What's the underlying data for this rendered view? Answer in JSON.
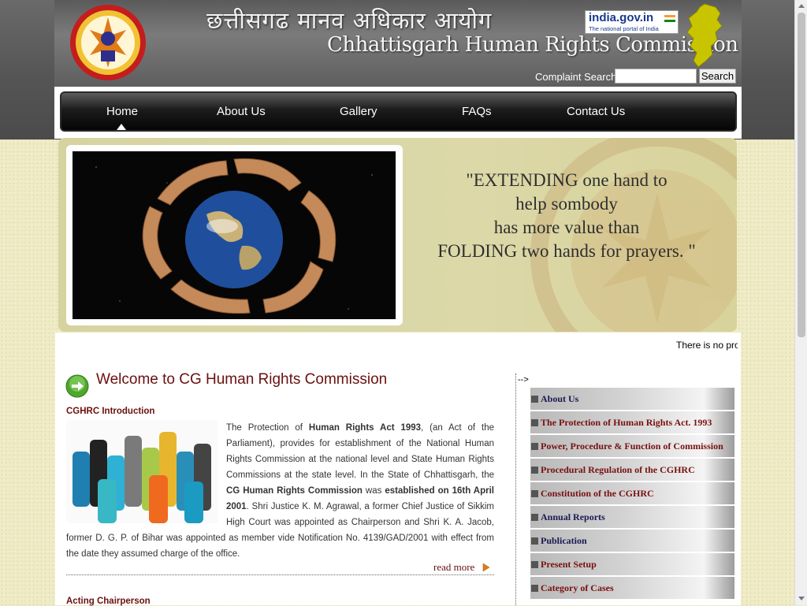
{
  "header": {
    "hindi_title": "छत्तीसगढ मानव अधिकार आयोग",
    "english_title": "Chhattisgarh Human Rights Commission",
    "india_gov": {
      "title": "india.gov.in",
      "subtitle": "The national portal of India"
    },
    "complaint_search_label": "Complaint Search:",
    "search_button": "Search",
    "search_value": ""
  },
  "nav": {
    "items": [
      {
        "label": "Home",
        "active": true
      },
      {
        "label": "About Us"
      },
      {
        "label": "Gallery"
      },
      {
        "label": "FAQs"
      },
      {
        "label": "Contact Us"
      }
    ]
  },
  "banner": {
    "quote_lines": [
      "\"EXTENDING one hand to",
      "help sombody",
      "has more value than",
      "FOLDING two hands for prayers. \""
    ]
  },
  "marquee": "There is no pro",
  "main": {
    "welcome_title": "Welcome to CG Human Rights Commission",
    "intro_heading": "CGHRC Introduction",
    "intro_parts": {
      "p1": "The Protection of ",
      "b1": "Human Rights Act 1993",
      "p2": ", (an Act of the Parliament), provides for establishment of the National Human Rights Commission at the national level and State Human Rights Commissions at the state level. In the State of Chhattisgarh, the ",
      "b2": "CG Human Rights Commission",
      "p3": " was ",
      "b3": "established on 16th April 2001",
      "p4": ". Shri Justice K. M. Agrawal, a former Chief Justice of Sikkim High Court was appointed as Chairperson and Shri K. A. Jacob, former D. G. P. of Bihar was appointed as member vide Notification No. 4139/GAD/2001 with effect from the date they assumed charge of the office."
    },
    "read_more": "read more",
    "acting_heading": "Acting Chairperson"
  },
  "stray_comment": "-->",
  "side_menu": {
    "items": [
      {
        "label": "About Us",
        "color": "#1a1a55"
      },
      {
        "label": "The Protection of Human Rights Act. 1993",
        "color": "#7a1010"
      },
      {
        "label": "Power, Procedure & Function of Commission",
        "color": "#7a1010"
      },
      {
        "label": "Procedural Regulation of the CGHRC",
        "color": "#7a1010"
      },
      {
        "label": "Constitution of the CGHRC",
        "color": "#7a1010"
      },
      {
        "label": "Annual Reports",
        "color": "#1a1a55"
      },
      {
        "label": "Publication",
        "color": "#1a1a55"
      },
      {
        "label": "Present Setup",
        "color": "#7a1010"
      },
      {
        "label": "Category of Cases",
        "color": "#7a1010"
      }
    ]
  },
  "colors": {
    "heading": "#6b1010",
    "banner_bg": "#d8d5a2",
    "page_bg": "#efebc5"
  }
}
